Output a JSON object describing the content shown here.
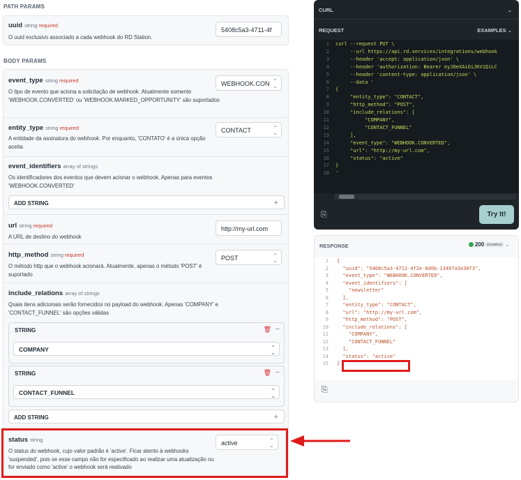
{
  "path_params": {
    "section_title": "PATH PARAMS",
    "uuid": {
      "name": "uuid",
      "type": "string",
      "required": "required",
      "description": "O uuid exclusivo associado a cada webhook do RD Station.",
      "value": "5408c5a3-4711-4f"
    }
  },
  "body_params": {
    "section_title": "BODY PARAMS",
    "event_type": {
      "name": "event_type",
      "type": "string",
      "required": "required",
      "description": "O tipo de evento que aciona a solicitação de webhook. Atualmente somente 'WEBHOOK.CONVERTED' ou 'WEBHOOK.MARKED_OPPORTUNITY' são suportados",
      "value": "WEBHOOK.CON"
    },
    "entity_type": {
      "name": "entity_type",
      "type": "string",
      "required": "required",
      "description": "A entidade da assinatura do webhook. Por enquanto, 'CONTATO' é a única opção aceita",
      "value": "CONTACT"
    },
    "event_identifiers": {
      "name": "event_identifiers",
      "type": "array of strings",
      "description": "Os identificadores dos eventos que devem acionar o webhook. Apenas para eventos 'WEBHOOK.CONVERTED'",
      "add_label": "ADD STRING",
      "add_icon": "+"
    },
    "url": {
      "name": "url",
      "type": "string",
      "required": "required",
      "description": "A URL de destino do webhook",
      "value": "http://my-url.com"
    },
    "http_method": {
      "name": "http_method",
      "type": "string",
      "required": "required",
      "description": "O método http que o webhook acionará. Atualmente, apenas o método 'POST' é suportado",
      "value": "POST"
    },
    "include_relations": {
      "name": "include_relations",
      "type": "array of strings",
      "description": "Quais itens adicionais serão fornecidos no payload do webhook. Apenas 'COMPANY' e 'CONTACT_FUNNEL' são opções válidas",
      "items": [
        {
          "label": "STRING",
          "value": "COMPANY"
        },
        {
          "label": "STRING",
          "value": "CONTACT_FUNNEL"
        }
      ],
      "add_label": "ADD STRING",
      "add_icon": "+",
      "remove_icon": "−"
    },
    "status": {
      "name": "status",
      "type": "string",
      "description": "O status do webhook, cujo valor padrão é 'active'. Ficar atento à webhooks 'suspended', pois se esse campo não for especificado ao realizar uma atualização ou for enviado como 'active' o webhook será reativado",
      "value": "active"
    }
  },
  "curl_panel": {
    "title": "CURL",
    "request_label": "REQUEST",
    "examples_label": "EXAMPLES",
    "code_lines": [
      "curl --request PUT \\",
      "     --url https://api.rd.services/integrations/webhook",
      "     --header 'accept: application/json' \\",
      "     --header 'authorization: Bearer eyJ0eXAiOiJKV1QiLC",
      "     --header 'content-type: application/json' \\",
      "     --data '",
      "{",
      "     \"entity_type\": \"CONTACT\",",
      "     \"http_method\": \"POST\",",
      "     \"include_relations\": [",
      "          \"COMPANY\",",
      "          \"CONTACT_FUNNEL\"",
      "     ],",
      "     \"event_type\": \"WEBHOOK.CONVERTED\",",
      "     \"url\": \"http://my-url.com\",",
      "     \"status\": \"active\"",
      "}",
      "'"
    ],
    "try_label": "Try It!"
  },
  "response_panel": {
    "title": "RESPONSE",
    "status_code": "200",
    "status_badge": "EXAMPLE",
    "code_lines": [
      "{",
      "  \"uuid\": \"5408c5a3-4711-4f2e-8d0b-13407a3e30f3\",",
      "  \"event_type\": \"WEBHOOK.CONVERTED\",",
      "  \"event_identifiers\": [",
      "    \"newsletter\"",
      "  ],",
      "  \"entity_type\": \"CONTACT\",",
      "  \"url\": \"http://my-url.com\",",
      "  \"http_method\": \"POST\",",
      "  \"include_relations\": [",
      "    \"COMPANY\",",
      "    \"CONTACT_FUNNEL\"",
      "  ],",
      "  \"status\": \"active\"",
      "}"
    ]
  },
  "colors": {
    "highlight": "#e01b1b",
    "code_bg": "#1e2428",
    "try_button": "#a8d0cf",
    "required": "#c0392b",
    "success": "#2ea44f"
  }
}
